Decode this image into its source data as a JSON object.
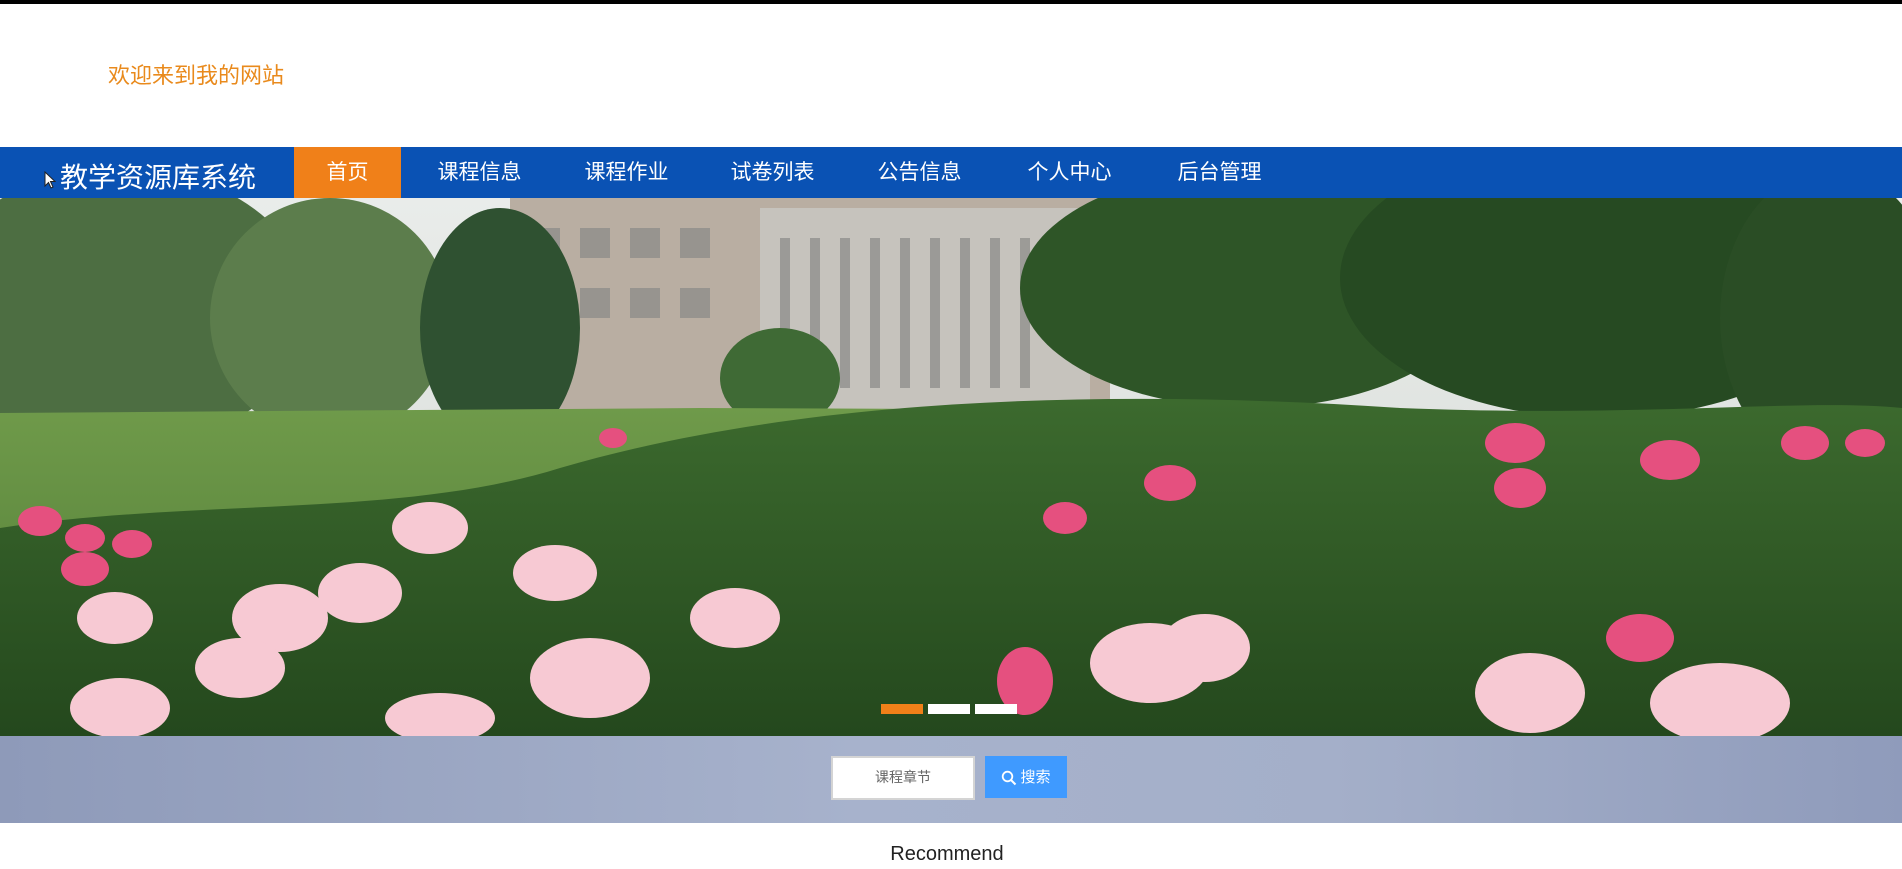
{
  "header": {
    "welcome": "欢迎来到我的网站"
  },
  "nav": {
    "brand": "教学资源库系统",
    "items": [
      {
        "label": "首页"
      },
      {
        "label": "课程信息"
      },
      {
        "label": "课程作业"
      },
      {
        "label": "试卷列表"
      },
      {
        "label": "公告信息"
      },
      {
        "label": "个人中心"
      },
      {
        "label": "后台管理"
      }
    ],
    "active_index": 0
  },
  "banner": {
    "slides_count": 3,
    "active_slide": 1,
    "icon": "campus-peony-garden"
  },
  "search": {
    "placeholder": "课程章节",
    "button_label": "搜索",
    "icon": "search-icon"
  },
  "section": {
    "title": "Recommend"
  },
  "colors": {
    "accent": "#f08019",
    "nav_bg": "#0a52b4",
    "search_button": "#3f9aff",
    "welcome_text": "#e98a1c"
  }
}
